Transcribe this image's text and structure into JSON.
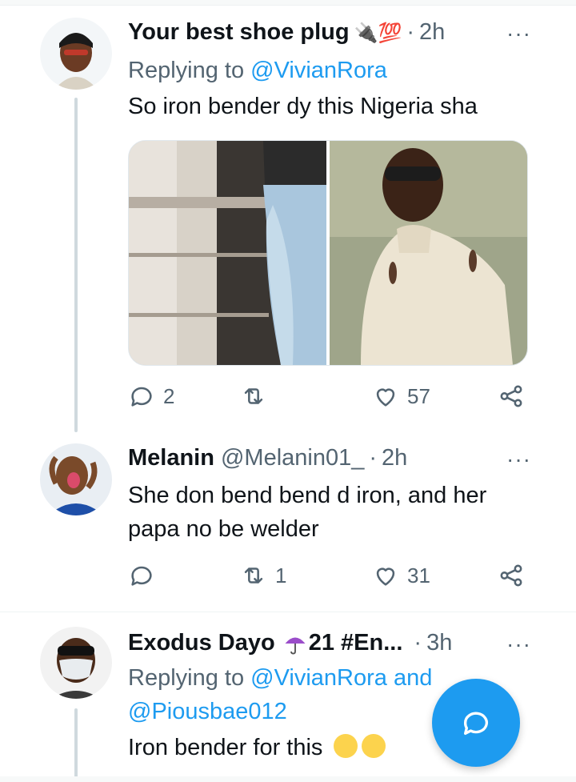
{
  "tweets": [
    {
      "name": "Your best shoe plug",
      "name_emoji": "🔌💯",
      "separator": "·",
      "time": "2h",
      "more": "···",
      "replying_prefix": "Replying to",
      "replying_to": "@VivianRora",
      "text": "So iron bender dy this Nigeria sha",
      "reply_count": "2",
      "retweet_count": "",
      "like_count": "57"
    },
    {
      "name": "Melanin",
      "handle": "@Melanin01_",
      "separator": "·",
      "time": "2h",
      "more": "···",
      "text": "She don bend bend d iron, and her papa no be welder",
      "reply_count": "",
      "retweet_count": "1",
      "like_count": "31"
    },
    {
      "name": "Exodus Dayo",
      "name_suffix": "21 #En...",
      "separator": "·",
      "time": "3h",
      "more": "···",
      "replying_prefix": "Replying to",
      "replying_to": "@VivianRora and",
      "replying_to_2": "@Piousbae012",
      "text": "Iron bender for this"
    }
  ],
  "colors": {
    "accent": "#1d9bf0",
    "secondary_text": "#536471",
    "thread_line": "#cfd9de"
  },
  "icons": {
    "reply": "reply-icon",
    "retweet": "retweet-icon",
    "like": "heart-icon",
    "share": "share-icon",
    "compose": "compose-reply-icon",
    "more": "more-icon"
  }
}
